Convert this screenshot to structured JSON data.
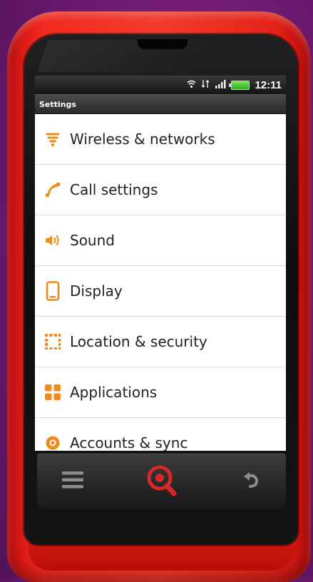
{
  "status_bar": {
    "time": "12:11",
    "icons": [
      "wifi-icon",
      "data-transfer-icon",
      "signal-icon",
      "battery-icon"
    ]
  },
  "header": {
    "title": "Settings"
  },
  "settings": {
    "items": [
      {
        "label": "Wireless & networks",
        "icon": "wifi-icon"
      },
      {
        "label": "Call settings",
        "icon": "phone-icon"
      },
      {
        "label": "Sound",
        "icon": "speaker-icon"
      },
      {
        "label": "Display",
        "icon": "display-icon"
      },
      {
        "label": "Location & security",
        "icon": "location-grid-icon"
      },
      {
        "label": "Applications",
        "icon": "applications-icon"
      },
      {
        "label": "Accounts & sync",
        "icon": "accounts-sync-icon"
      }
    ]
  },
  "nav": {
    "buttons": [
      "menu-icon",
      "search-icon",
      "back-icon"
    ]
  },
  "colors": {
    "accent": "#f08a1c",
    "phone_body": "#e8271d",
    "background": "#741b78"
  }
}
